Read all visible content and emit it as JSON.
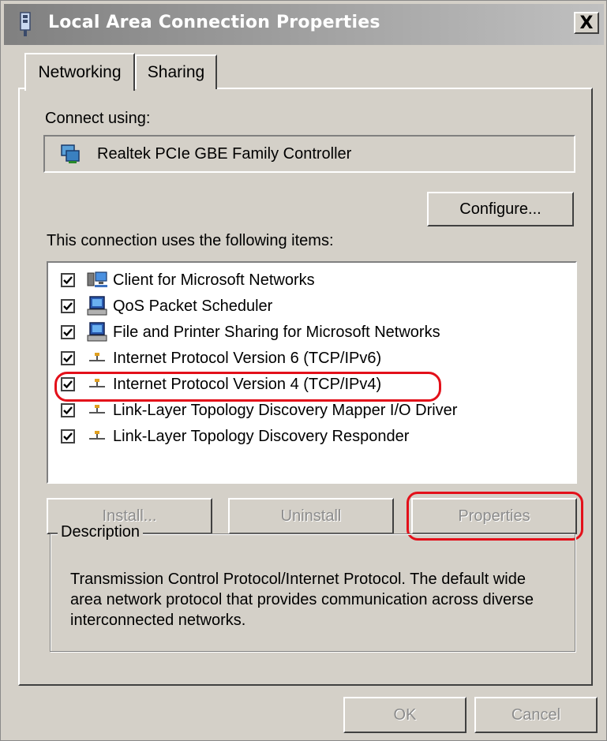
{
  "window": {
    "title": "Local Area Connection Properties",
    "close_label": "X"
  },
  "tabs": [
    {
      "label": "Networking",
      "active": true
    },
    {
      "label": "Sharing",
      "active": false
    }
  ],
  "connect": {
    "label": "Connect using:",
    "adapter": "Realtek PCIe GBE Family Controller",
    "configure_label": "Configure..."
  },
  "items": {
    "label": "This connection uses the following items:",
    "list": [
      {
        "label": "Client for Microsoft Networks",
        "checked": true,
        "icon": "network-client-icon"
      },
      {
        "label": "QoS Packet Scheduler",
        "checked": true,
        "icon": "computer-service-icon"
      },
      {
        "label": "File and Printer Sharing for Microsoft Networks",
        "checked": true,
        "icon": "computer-service-icon"
      },
      {
        "label": "Internet Protocol Version 6 (TCP/IPv6)",
        "checked": true,
        "icon": "protocol-icon"
      },
      {
        "label": "Internet Protocol Version 4 (TCP/IPv4)",
        "checked": true,
        "icon": "protocol-icon",
        "highlighted": true
      },
      {
        "label": "Link-Layer Topology Discovery Mapper I/O Driver",
        "checked": true,
        "icon": "protocol-icon"
      },
      {
        "label": "Link-Layer Topology Discovery Responder",
        "checked": true,
        "icon": "protocol-icon"
      }
    ]
  },
  "actions": {
    "install_label": "Install...",
    "uninstall_label": "Uninstall",
    "properties_label": "Properties"
  },
  "description": {
    "label": "Description",
    "text": "Transmission Control Protocol/Internet Protocol. The default wide area network protocol that provides communication across diverse interconnected networks."
  },
  "footer": {
    "ok_label": "OK",
    "cancel_label": "Cancel"
  },
  "colors": {
    "highlight": "#e3101a",
    "face": "#d4d0c8"
  }
}
